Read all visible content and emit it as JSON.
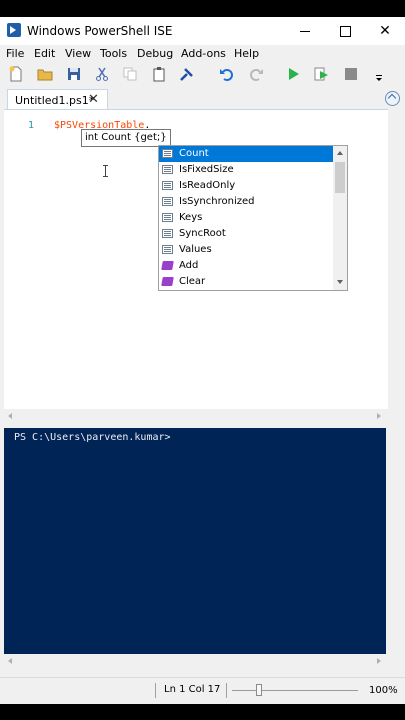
{
  "window": {
    "title": "Windows PowerShell ISE"
  },
  "menu": [
    "File",
    "Edit",
    "View",
    "Tools",
    "Debug",
    "Add-ons",
    "Help"
  ],
  "toolbar": {
    "icons": [
      "new-file-icon",
      "open-folder-icon",
      "save-icon",
      "cut-icon",
      "copy-icon",
      "paste-icon",
      "clear-console-icon",
      "undo-icon",
      "redo-icon",
      "run-script-icon",
      "run-selection-icon",
      "stop-icon",
      "toolbar-overflow-icon"
    ],
    "colors": {
      "run": "#2bb24c",
      "undo": "#1e6fd9",
      "open": "#e8b84a"
    }
  },
  "tabs": [
    {
      "label": "Untitled1.ps1*",
      "close": "✕"
    }
  ],
  "editor": {
    "line_number": "1",
    "code_token": "$PSVersionTable",
    "code_dot": ".",
    "tooltip": "int Count {get;}",
    "token_color": "#ff4500"
  },
  "intellisense": {
    "items": [
      {
        "label": "Count",
        "kind": "property",
        "selected": true
      },
      {
        "label": "IsFixedSize",
        "kind": "property"
      },
      {
        "label": "IsReadOnly",
        "kind": "property"
      },
      {
        "label": "IsSynchronized",
        "kind": "property"
      },
      {
        "label": "Keys",
        "kind": "property"
      },
      {
        "label": "SyncRoot",
        "kind": "property"
      },
      {
        "label": "Values",
        "kind": "property"
      },
      {
        "label": "Add",
        "kind": "method"
      },
      {
        "label": "Clear",
        "kind": "method"
      }
    ]
  },
  "console": {
    "prompt": "PS C:\\Users\\parveen.kumar>",
    "background": "#012456"
  },
  "status": {
    "position": "Ln 1  Col 17",
    "zoom": "100%",
    "zoom_level": 100
  }
}
